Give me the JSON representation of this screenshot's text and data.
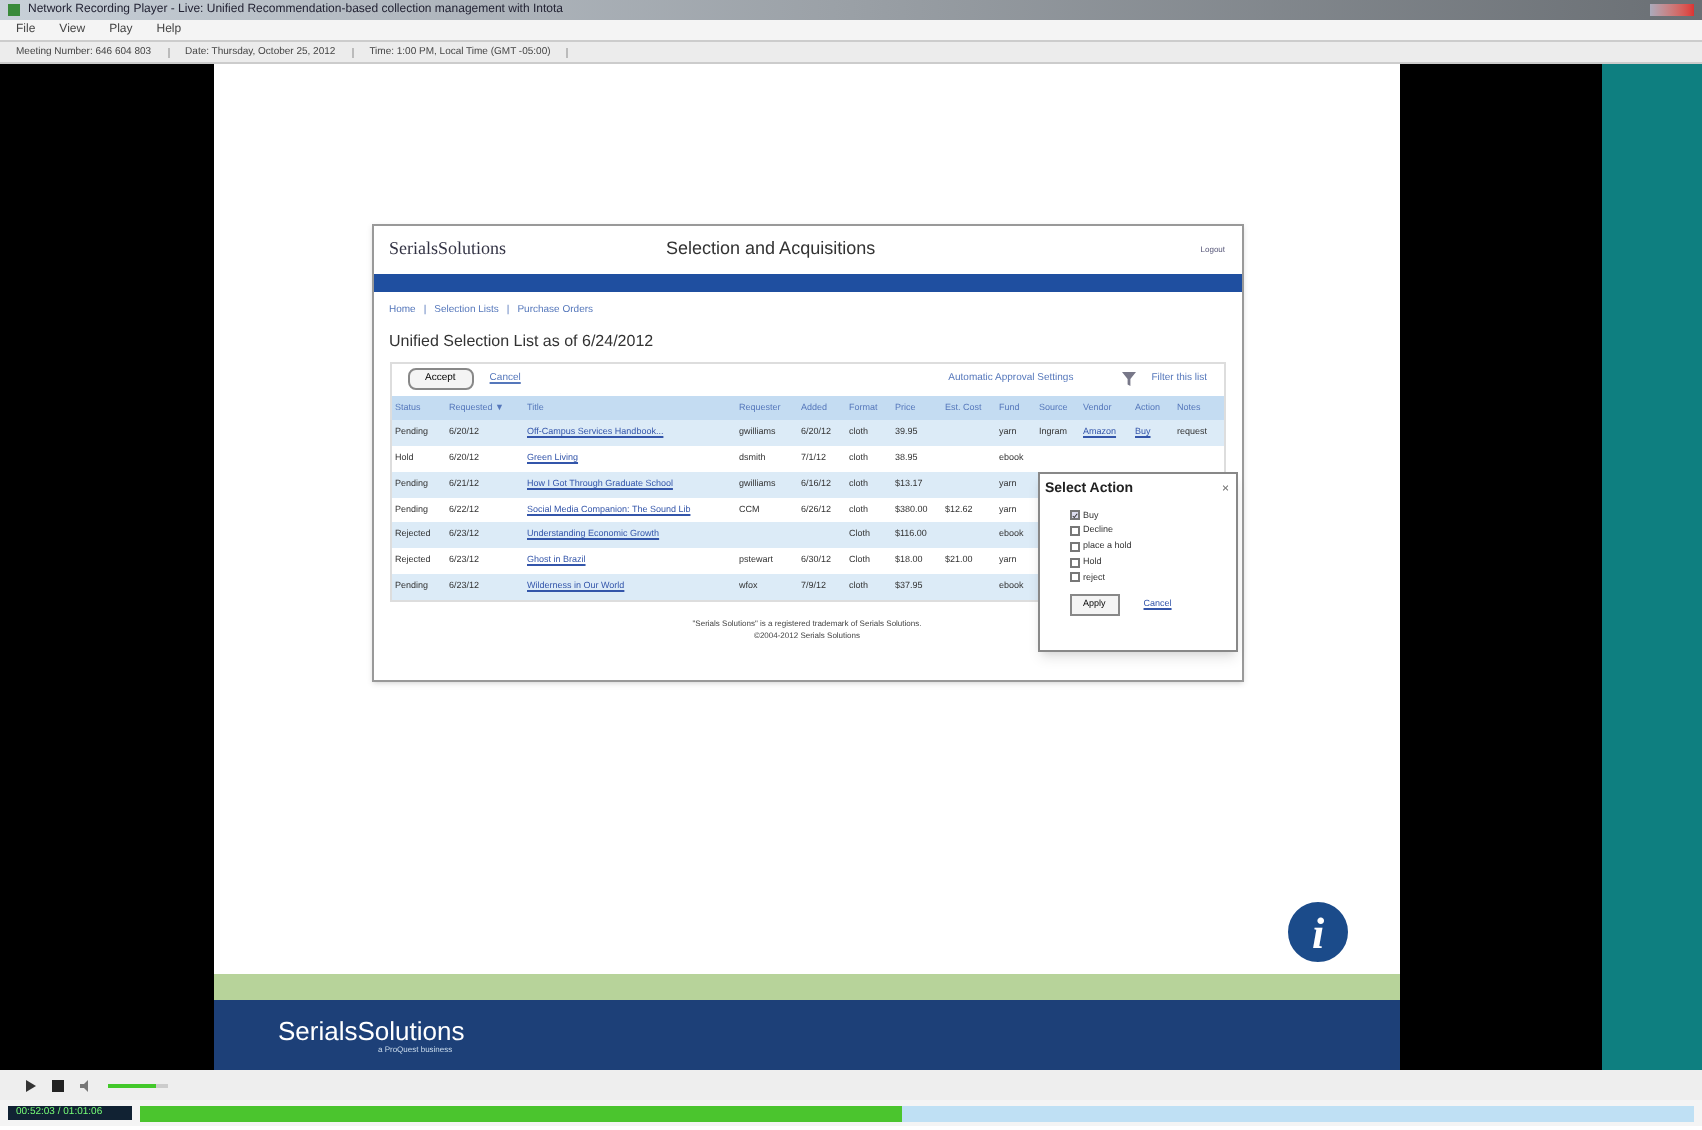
{
  "window": {
    "title": "Network Recording Player - Live: Unified Recommendation-based collection management with Intota"
  },
  "menu": [
    "File",
    "View",
    "Play",
    "Help"
  ],
  "info_bar": [
    "Meeting Number: 646 604 803",
    "Date: Thursday, October 25, 2012",
    "Time: 1:00 PM, Local Time (GMT -05:00)"
  ],
  "app": {
    "logo": "SerialsSolutions",
    "title": "Selection and Acquisitions",
    "logout": "Logout",
    "breadcrumbs": [
      "Home",
      "Selection Lists",
      "Purchase Orders"
    ],
    "separator": "|",
    "heading": "Unified Selection List as of 6/24/2012",
    "accept": "Accept",
    "cancel": "Cancel",
    "approval_link": "Automatic Approval Settings",
    "filter": "Filter this list",
    "columns": [
      "Status",
      "Requested ▼",
      "Title",
      "Requester",
      "Added",
      "Format",
      "Price",
      "Est. Cost",
      "Fund",
      "Source",
      "Vendor",
      "Action",
      "Notes"
    ],
    "rows": [
      {
        "cells": [
          "Pending",
          "6/20/12",
          "Off-Campus Services Handbook...",
          "gwilliams",
          "6/20/12",
          "cloth",
          "39.95",
          "",
          "yarn",
          "Ingram",
          "Amazon",
          "Buy",
          "request"
        ]
      },
      {
        "cells": [
          "Hold",
          "6/20/12",
          "Green Living",
          "dsmith",
          "7/1/12",
          "cloth",
          "38.95",
          "",
          "ebook"
        ]
      },
      {
        "cells": [
          "Pending",
          "6/21/12",
          "How I Got Through Graduate School",
          "gwilliams",
          "6/16/12",
          "cloth",
          "$13.17",
          "",
          "yarn"
        ]
      },
      {
        "cells": [
          "Pending",
          "6/22/12",
          "Social Media Companion: The Sound Lib",
          "CCM",
          "6/26/12",
          "cloth",
          "$380.00",
          "$12.62",
          "yarn"
        ]
      },
      {
        "cells": [
          "Rejected",
          "6/23/12",
          "Understanding Economic Growth",
          "",
          "",
          "Cloth",
          "$116.00",
          "",
          "ebook"
        ]
      },
      {
        "cells": [
          "Rejected",
          "6/23/12",
          "Ghost in Brazil",
          "pstewart",
          "6/30/12",
          "Cloth",
          "$18.00",
          "$21.00",
          "yarn"
        ]
      },
      {
        "cells": [
          "Pending",
          "6/23/12",
          "Wilderness in Our World",
          "wfox",
          "7/9/12",
          "cloth",
          "$37.95",
          "",
          "ebook"
        ]
      }
    ],
    "popup": {
      "title": "Select Action",
      "close": "×",
      "options": [
        {
          "label": "Buy",
          "checked": true
        },
        {
          "label": "Decline",
          "checked": false
        },
        {
          "label": "place a hold",
          "checked": false
        },
        {
          "label": "Hold",
          "checked": false
        },
        {
          "label": "reject",
          "checked": false
        }
      ],
      "apply": "Apply",
      "cancel": "Cancel"
    },
    "footer": [
      "\"Serials Solutions\" is a registered trademark of Serials Solutions.",
      "©2004-2012 Serials Solutions"
    ]
  },
  "slide_logo": "SerialsSolutions",
  "slide_tagline": "a ProQuest business",
  "info_symbol": "i",
  "player": {
    "volume": {
      "level": 0.8
    },
    "time": "00:52:03 / 01:01:06",
    "level": 0.49
  }
}
